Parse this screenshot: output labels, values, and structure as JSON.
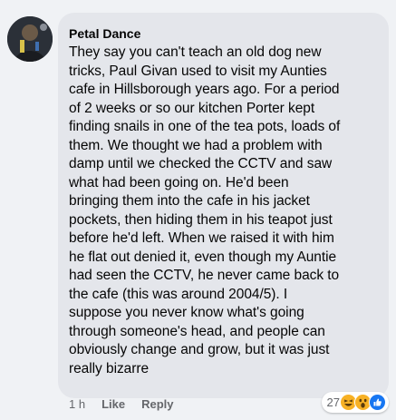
{
  "comment": {
    "author": "Petal Dance",
    "text": "They say you can't teach an old dog new\ntricks, Paul Givan used to visit my Aunties\ncafe in Hillsborough years ago. For a period\nof 2 weeks or so our kitchen Porter kept\nfinding snails in one of the tea pots, loads of\nthem. We thought we had a problem with\ndamp until we checked the CCTV and saw\nwhat had been going on. He'd been\nbringing them into the cafe in his jacket\npockets, then hiding them in his teapot just\nbefore he'd left. When we raised it with him\nhe flat out denied it, even though my Auntie\nhad seen the CCTV, he never came back to\nthe cafe (this was around 2004/5). I\nsuppose you never know what's going\nthrough someone's head, and people can\nobviously change and grow, but it was just\nreally bizarre"
  },
  "actions": {
    "time": "1 h",
    "like_label": "Like",
    "reply_label": "Reply"
  },
  "reactions": {
    "count": "27",
    "icons": [
      "haha-icon",
      "wow-icon",
      "like-icon"
    ],
    "colors": {
      "haha": "#f7b125",
      "wow": "#f7b125",
      "like": "#1877f2"
    }
  },
  "theme": {
    "bubble_bg": "#e4e6eb",
    "page_bg": "#f0f2f5",
    "meta_text": "#65676b"
  }
}
